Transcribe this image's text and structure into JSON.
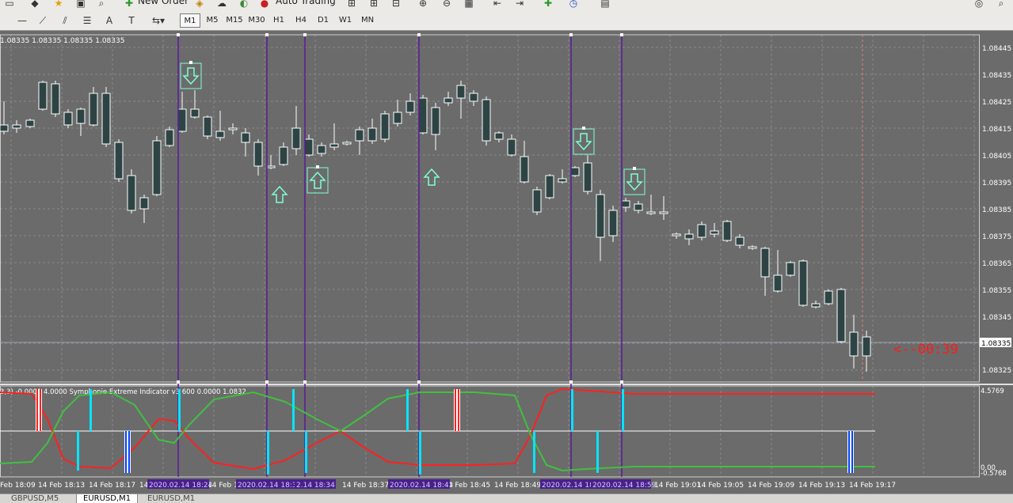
{
  "toolbar": {
    "new_order": "New Order",
    "auto_trading": "Auto Trading",
    "timeframes": [
      "M1",
      "M5",
      "M15",
      "M30",
      "H1",
      "H4",
      "D1",
      "W1",
      "MN"
    ],
    "active_timeframe": "M1"
  },
  "chart": {
    "ohlc_label": "1.08335 1.08335 1.08335 1.08335",
    "price_ticks": [
      "1.08445",
      "1.08435",
      "1.08425",
      "1.08415",
      "1.08405",
      "1.08395",
      "1.08385",
      "1.08375",
      "1.08365",
      "1.08355",
      "1.08345",
      "1.08335",
      "1.08325"
    ],
    "current_price": "1.08335",
    "countdown": "<--00:39",
    "indicator_label": "3,3) -0.0000 4.0000  Symphonie Extreme Indicator v3 600 0.0000 1.0832",
    "indicator_ticks": [
      "4.5769",
      "0.00",
      "-0.5768"
    ],
    "time_labels": [
      "Feb 18:09",
      "14 Feb 18:13",
      "14 Feb 18:17",
      "14",
      "14 Feb 18:25",
      "14 Feb 18:37",
      "14 Feb 18:45",
      "14 Feb 18:49",
      "14 Feb 19:01",
      "14 Feb 19:05",
      "14 Feb 19:09",
      "14 Feb 19:13",
      "14 Feb 19:17"
    ],
    "highlight_labels": [
      "2020.02.14 18:24",
      "2020.02.14 18:31",
      "2.14 18:34",
      "2020.02.14 18:43",
      "2020.02.14 18",
      "2020.02.14 18:59"
    ],
    "colors": {
      "background": "#6b6b6b",
      "bull": "#ffffff",
      "bear": "#2e4444",
      "vline": "#5a1a9a",
      "arrow": "#7fffd4",
      "red_line": "#ff2020",
      "green_line": "#40c040",
      "cyan_bar": "#00e5ff",
      "blue_bar": "#0040ff"
    }
  },
  "tabs": [
    "GBPUSD,M5",
    "EURUSD,M1",
    "EURUSD,M1"
  ],
  "active_tab": "EURUSD,M1"
}
